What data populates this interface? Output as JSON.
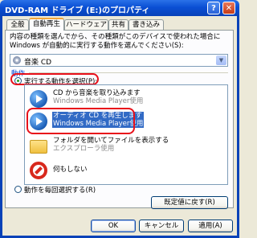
{
  "window": {
    "title": "DVD-RAM ドライブ (E:)のプロパティ",
    "help_glyph": "?",
    "close_glyph": "✕"
  },
  "tabs": [
    {
      "label": "全般"
    },
    {
      "label": "自動再生"
    },
    {
      "label": "ハードウェア"
    },
    {
      "label": "共有"
    },
    {
      "label": "書き込み"
    }
  ],
  "description": "内容の種類を選んでから、その種類がこのデバイスで使われた場合に Windows が自動的に実行する動作を選んでください(S):",
  "content_type": {
    "value": "音楽 CD"
  },
  "actions_group": {
    "label": "動作",
    "select_action_radio": "実行する動作を選択(P):",
    "prompt_each_time_radio": "動作を毎回選択する(R)"
  },
  "action_items": [
    {
      "title": "CD から音楽を取り込みます",
      "subtitle": "Windows Media Player使用",
      "icon": "windows-media-player-icon"
    },
    {
      "title": "オーディオ CD を再生します",
      "subtitle": "Windows Media Player使用",
      "icon": "windows-media-player-icon"
    },
    {
      "title": "フォルダを開いてファイルを表示する",
      "subtitle": "エクスプローラ使用",
      "icon": "folder-icon"
    },
    {
      "title": "何もしない",
      "subtitle": "",
      "icon": "no-action-icon"
    }
  ],
  "buttons": {
    "restore": "既定値に戻す(R)",
    "ok": "OK",
    "cancel": "キャンセル",
    "apply": "適用(A)"
  },
  "colors": {
    "titlebar": "#0a4fd4",
    "selection": "#316ac5",
    "highlight_ring": "#e8101a"
  }
}
